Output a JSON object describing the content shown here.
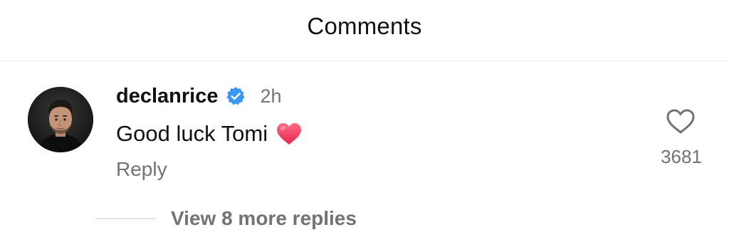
{
  "header": {
    "title": "Comments"
  },
  "comment": {
    "username": "declanrice",
    "verified": true,
    "timestamp": "2h",
    "text": "Good luck Tomi",
    "emoji": "heart",
    "reply_label": "Reply",
    "like_count": "3681",
    "view_replies_label": "View 8 more replies"
  },
  "colors": {
    "verified_badge": "#3897f0",
    "secondary_text": "#737373",
    "heart_emoji": "#f23b5f"
  },
  "icons": {
    "verified": "verified-badge-icon",
    "emoji": "heart-emoji-icon",
    "like": "heart-outline-icon"
  }
}
